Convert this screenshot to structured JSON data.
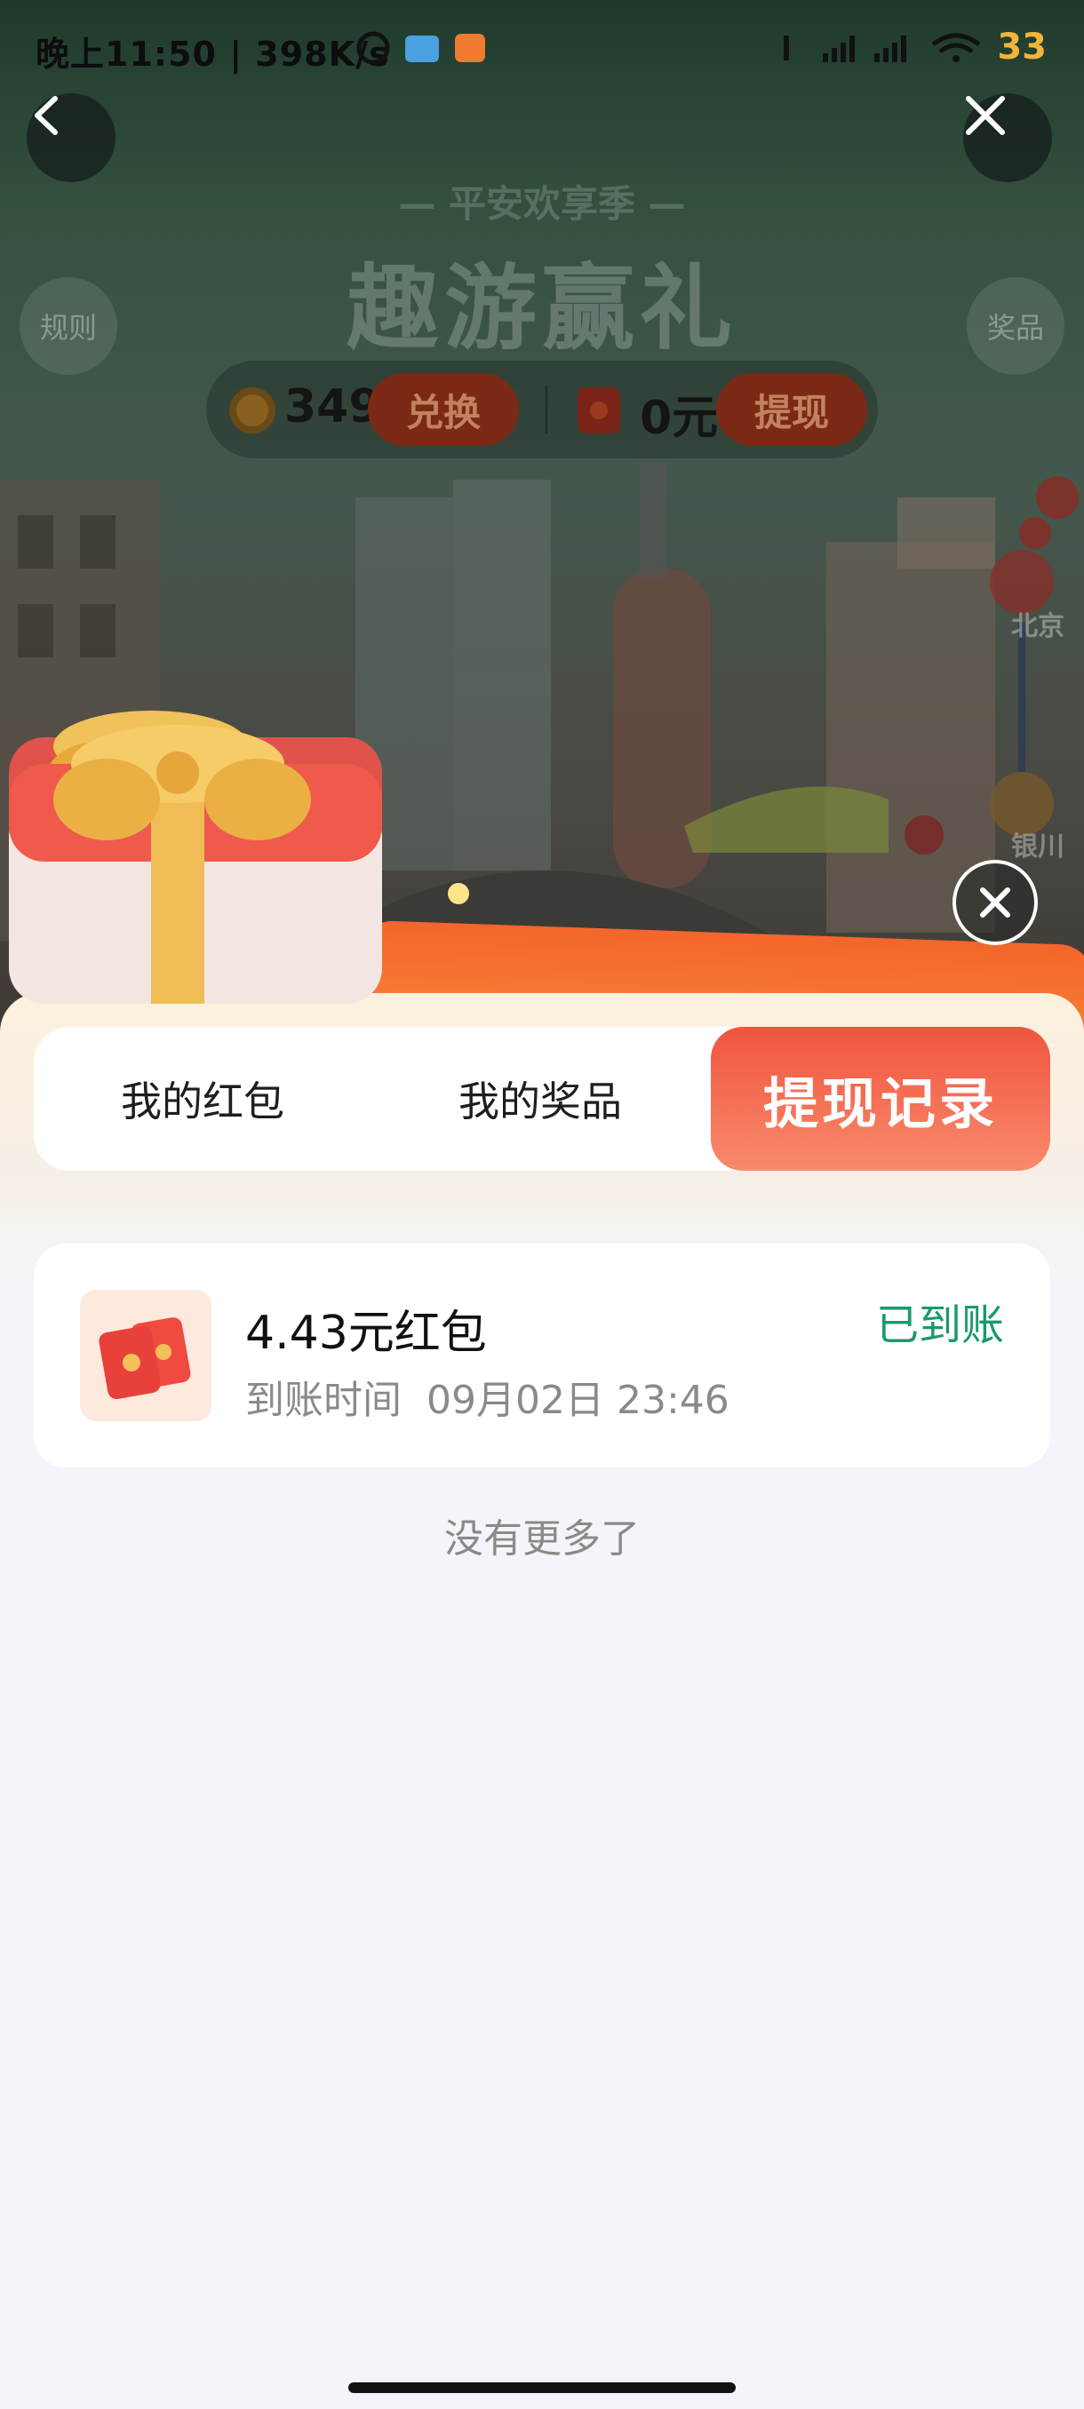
{
  "status_bar": {
    "time_speed": "晚上11:50 | 398K/s",
    "battery": "33"
  },
  "game": {
    "subtitle": "— 平安欢享季 —",
    "title": "趣游赢礼",
    "rules_label": "规则",
    "prizes_label": "奖品",
    "coins": "349",
    "exchange_label": "兑换",
    "cash": "0元",
    "withdraw_label": "提现",
    "cities": [
      "北京",
      "银川"
    ]
  },
  "sheet": {
    "tabs": [
      {
        "label": "我的红包",
        "active": false
      },
      {
        "label": "我的奖品",
        "active": false
      },
      {
        "label": "提现记录",
        "active": true
      }
    ],
    "records": [
      {
        "amount": "4.43元红包",
        "time_label": "到账时间",
        "time_value": "09月02日 23:46",
        "status": "已到账"
      }
    ],
    "no_more": "没有更多了"
  },
  "colors": {
    "accent": "#f0553e",
    "success": "#1b9a6a",
    "battery": "#f4b43a"
  }
}
